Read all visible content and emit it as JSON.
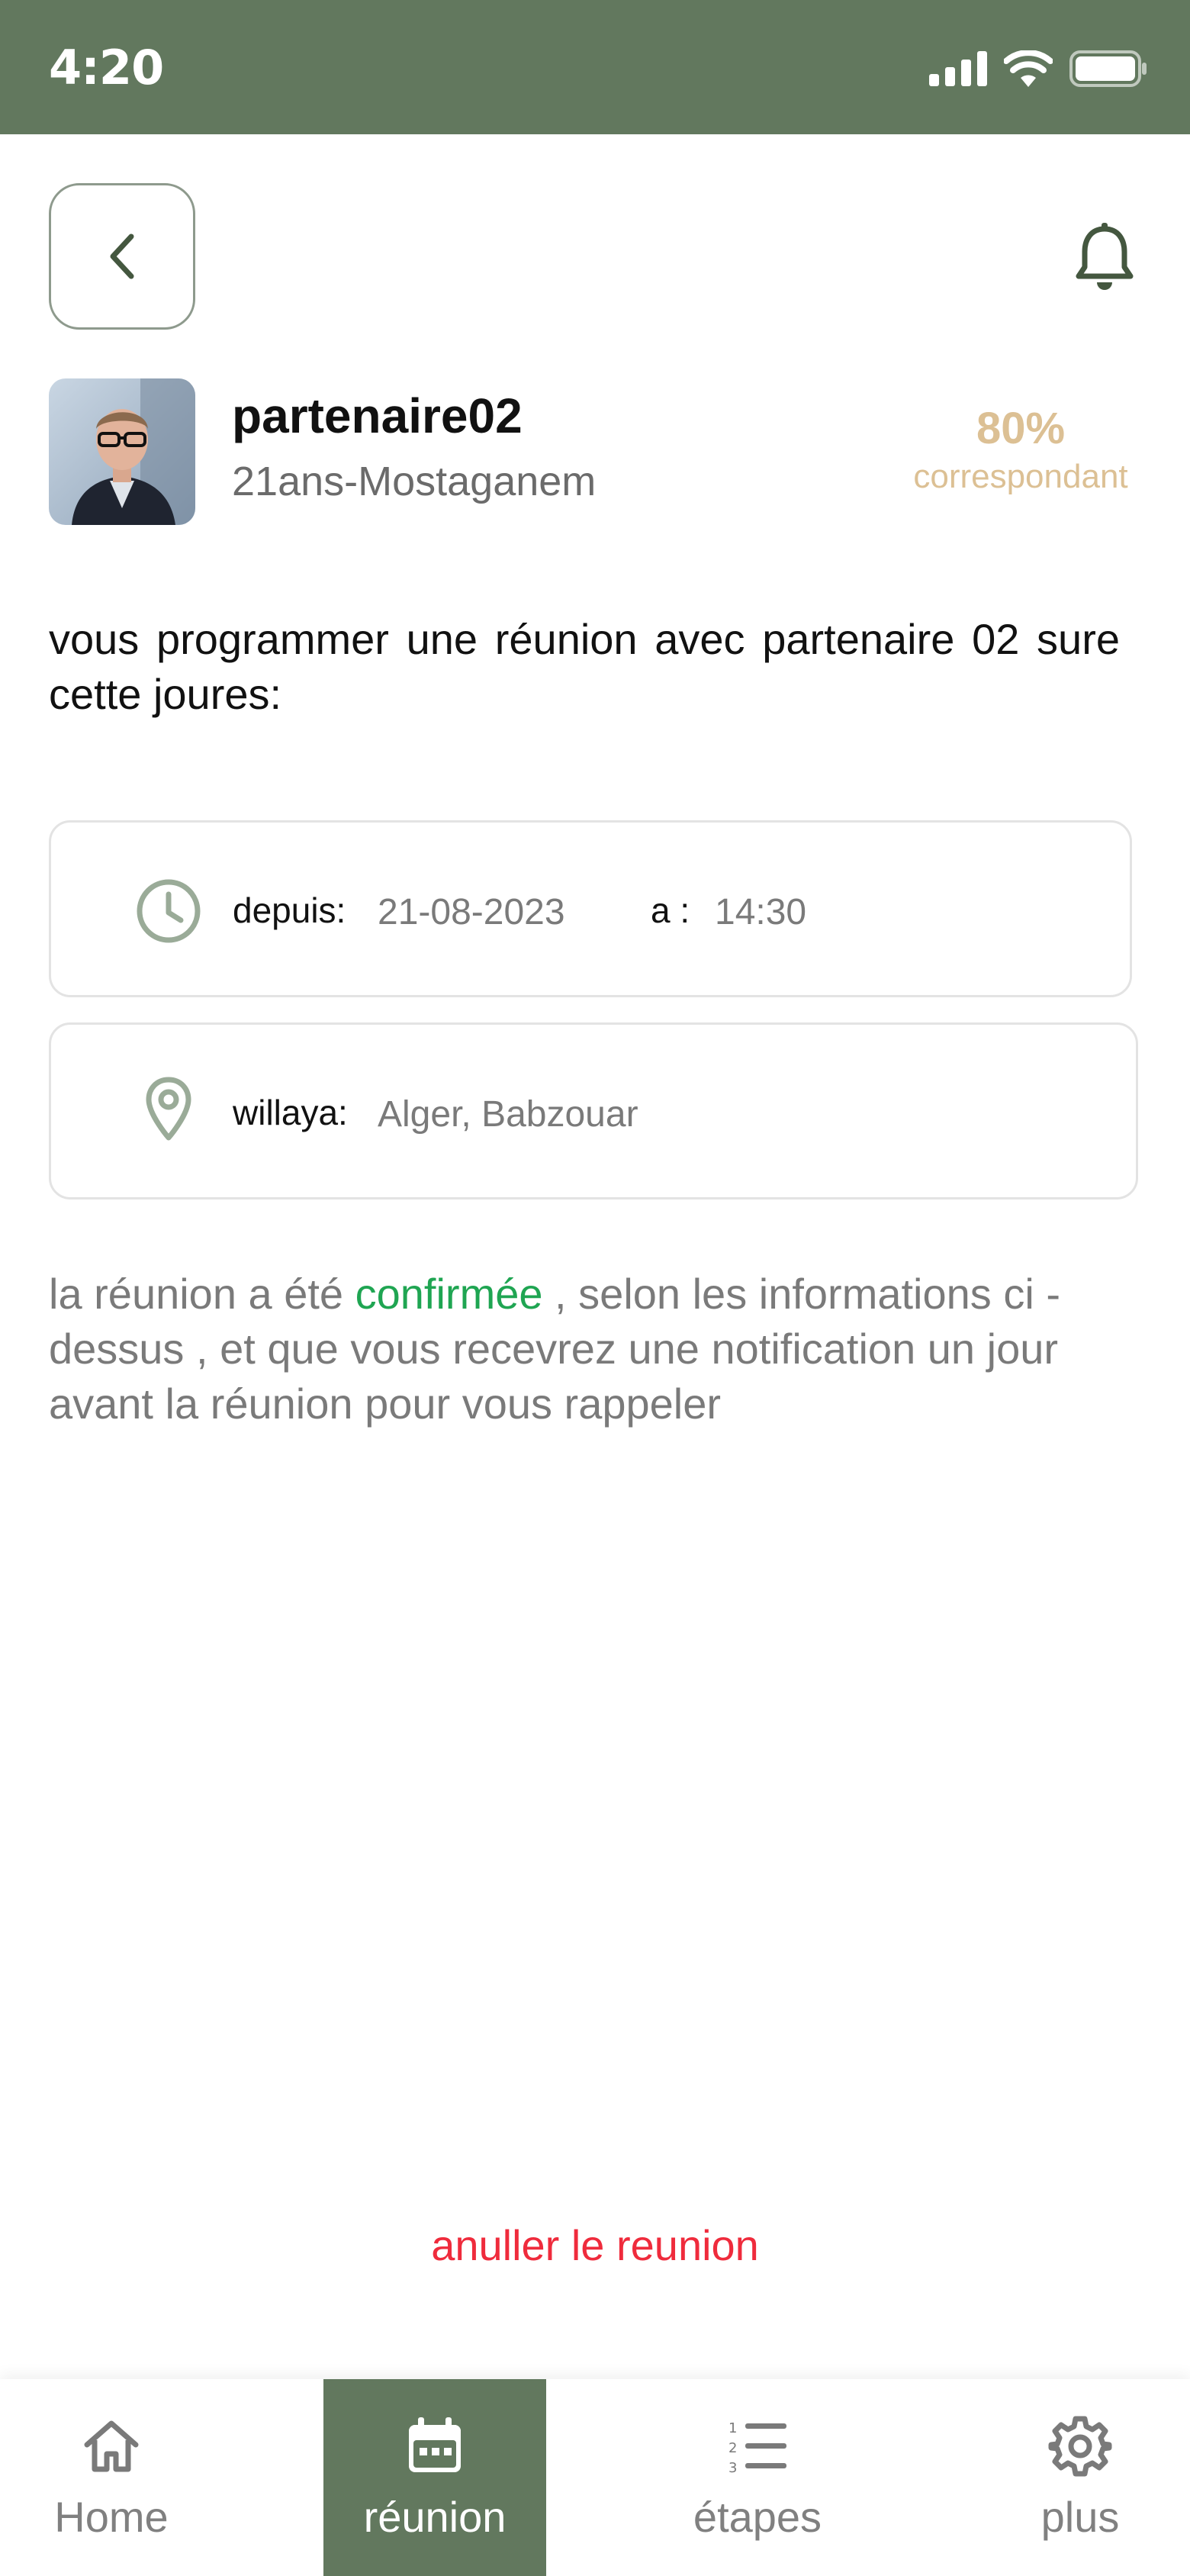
{
  "status_bar": {
    "time": "4:20",
    "icons": [
      "signal-icon",
      "wifi-icon",
      "battery-icon"
    ]
  },
  "header": {
    "back_icon": "chevron-left-icon",
    "notification_icon": "bell-icon"
  },
  "profile": {
    "name": "partenaire02",
    "subtitle": "21ans-Mostaganem",
    "match_percent": "80%",
    "match_label": "correspondant"
  },
  "intro_text": "vous programmer une réunion avec partenaire 02 sure cette joures:",
  "schedule": {
    "date_label": "depuis:",
    "date_value": "21-08-2023",
    "time_label": "a :",
    "time_value": "14:30",
    "location_label": "willaya:",
    "location_value": "Alger, Babzouar"
  },
  "confirmation": {
    "before": "la réunion a été ",
    "highlight": "confirmée",
    "after": " , selon les informations ci - dessus , et que vous recevrez une notification un jour avant la réunion pour vous rappeler"
  },
  "cancel_label": "anuller le reunion",
  "bottom_nav": {
    "items": [
      {
        "label": "Home",
        "icon": "home-icon"
      },
      {
        "label": "réunion",
        "icon": "calendar-icon",
        "active": true
      },
      {
        "label": "étapes",
        "icon": "numbered-list-icon"
      },
      {
        "label": "plus",
        "icon": "gear-icon"
      }
    ]
  },
  "colors": {
    "primary": "#62785E",
    "match": "#DCC094",
    "confirmed": "#1FA552",
    "cancel": "#EF2B3C"
  }
}
